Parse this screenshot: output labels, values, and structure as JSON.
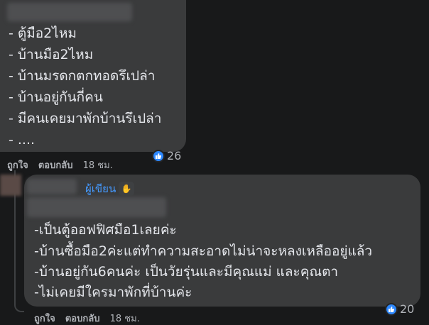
{
  "comment1": {
    "lines": [
      "- ตู้มือ2ไหม",
      "- บ้านมือ2ไหม",
      "- บ้านมรดกตกทอดรึเปล่า",
      "- บ้านอยู่กันกี่คน",
      "- มีคนเคยมาพักบ้านรึเปล่า",
      "- ...."
    ],
    "like_label": "ถูกใจ",
    "reply_label": "ตอบกลับ",
    "time": "18 ชม.",
    "reaction_count": "26"
  },
  "comment2": {
    "author_badge": "ผู้เขียน",
    "badge_icon": "wave-hand-icon",
    "lines": [
      "-เป็นตู้ออฟฟิศมือ1เลยค่ะ",
      "-บ้านซื้อมือ2ค่ะแต่ทำความสะอาดไม่น่าจะหลงเหลืออยู่แล้ว",
      "-บ้านอยู่กัน6คนค่ะ เป็นวัยรุ่นและมีคุณแม่ และคุณตา",
      "-ไม่เคยมีใครมาพักที่บ้านค่ะ"
    ],
    "like_label": "ถูกใจ",
    "reply_label": "ตอบกลับ",
    "time": "18 ชม.",
    "reaction_count": "20"
  },
  "colors": {
    "background": "#18191a",
    "bubble": "#3a3b3c",
    "text": "#e4e6eb",
    "secondary": "#b0b3b8",
    "accent": "#4599ff",
    "like": "#2d88ff"
  }
}
